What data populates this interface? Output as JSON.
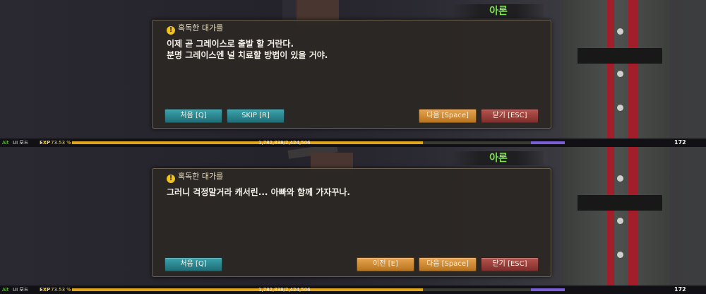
{
  "panels": [
    {
      "speaker": "아론",
      "title": "혹독한 대가를",
      "lines": [
        "이제 곧 그레이스로 출발 할 거란다.",
        "분명 그레이스엔 널 치료할 방법이 있을 거야."
      ],
      "buttons": {
        "first": "처음 [Q]",
        "skip": "SKIP [R]",
        "next": "다음 [Space]",
        "close": "닫기 [ESC]"
      },
      "status": {
        "alt": "Alt",
        "ui_mode": "UI 모드",
        "exp_label": "EXP",
        "exp_percent": "73.53 %",
        "exp_numbers": "1,782,838/2,424,506",
        "level": "172"
      },
      "exp_fraction": 0.7353
    },
    {
      "speaker": "아론",
      "title": "혹독한 대가를",
      "lines": [
        "그러니 걱정말거라 캐서린... 아빠와 함께 가자꾸나."
      ],
      "buttons": {
        "first": "처음 [Q]",
        "prev": "이전 [E]",
        "next": "다음 [Space]",
        "close": "닫기 [ESC]"
      },
      "status": {
        "alt": "Alt",
        "ui_mode": "UI 모드",
        "exp_label": "EXP",
        "exp_percent": "73.53 %",
        "exp_numbers": "1,782,838/2,424,506",
        "level": "172"
      },
      "exp_fraction": 0.7353
    }
  ],
  "colors": {
    "speaker": "#7ee34f",
    "accent_exp": "#e1a51e",
    "teal_button": "#2b8b95",
    "orange_button": "#d58a33",
    "red_button": "#9c403c"
  }
}
